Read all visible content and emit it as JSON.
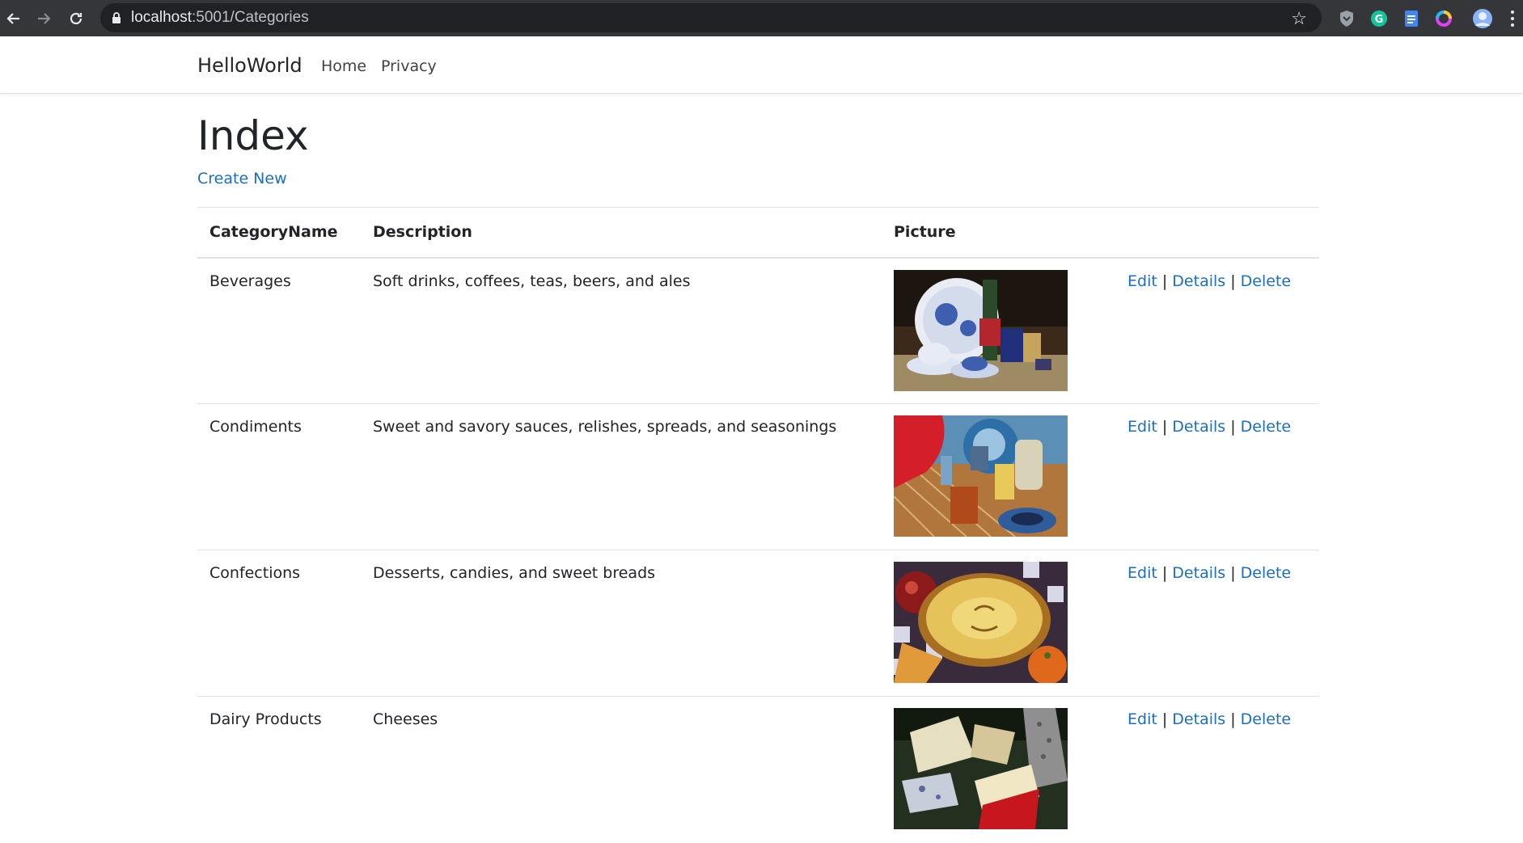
{
  "browser": {
    "url_host": "localhost",
    "url_rest": ":5001/Categories"
  },
  "navbar": {
    "brand": "HelloWorld",
    "links": [
      {
        "label": "Home"
      },
      {
        "label": "Privacy"
      }
    ]
  },
  "main": {
    "title": "Index",
    "create_link": "Create New",
    "table": {
      "headers": [
        "CategoryName",
        "Description",
        "Picture",
        ""
      ],
      "rows": [
        {
          "name": "Beverages",
          "description": "Soft drinks, coffees, teas, beers, and ales",
          "picture": "beverages-image"
        },
        {
          "name": "Condiments",
          "description": "Sweet and savory sauces, relishes, spreads, and seasonings",
          "picture": "condiments-image"
        },
        {
          "name": "Confections",
          "description": "Desserts, candies, and sweet breads",
          "picture": "confections-image"
        },
        {
          "name": "Dairy Products",
          "description": "Cheeses",
          "picture": "dairy-image"
        }
      ],
      "actions": {
        "edit": "Edit",
        "details": "Details",
        "delete": "Delete",
        "separator": "|"
      }
    }
  },
  "colors": {
    "link": "#1b6ec2",
    "text": "#212529",
    "chrome": "#35363a"
  }
}
